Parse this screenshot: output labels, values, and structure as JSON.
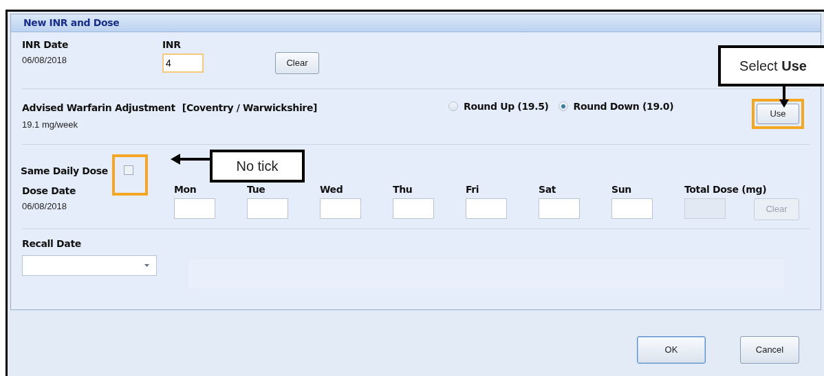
{
  "window": {
    "title": "New INR and Dose"
  },
  "inr_date": {
    "label": "INR Date",
    "value": "06/08/2018"
  },
  "inr": {
    "label": "INR",
    "value": "4",
    "focused": true
  },
  "inr_clear_button": {
    "label": "Clear"
  },
  "advice": {
    "label": "Advised Warfarin Adjustment",
    "region": "[Coventry / Warwickshire]",
    "value": "19.1 mg/week"
  },
  "rounding": [
    {
      "label": "Round Up (19.5)",
      "selected": false
    },
    {
      "label": "Round Down (19.0)",
      "selected": true
    }
  ],
  "use_button": {
    "label": "Use",
    "highlighted": true
  },
  "same_daily_dose": {
    "label": "Same Daily Dose",
    "checked": false,
    "highlighted": true
  },
  "dose": {
    "date_label": "Dose Date",
    "date": "06/08/2018",
    "days": [
      {
        "label": "Mon"
      },
      {
        "label": "Tue"
      },
      {
        "label": "Wed"
      },
      {
        "label": "Thu"
      },
      {
        "label": "Fri"
      },
      {
        "label": "Sat"
      },
      {
        "label": "Sun"
      }
    ],
    "total": {
      "label": "Total Dose (mg)",
      "disabled": true
    },
    "clear_button": {
      "label": "Clear",
      "disabled": true
    }
  },
  "recall_date": {
    "label": "Recall Date"
  },
  "buttons": [
    {
      "label": "OK",
      "default": true
    },
    {
      "label": "Cancel",
      "default": false
    }
  ],
  "annotations": [
    {
      "text": "Select **Use**",
      "kind": "down"
    },
    {
      "text": "No tick",
      "kind": "left"
    }
  ]
}
